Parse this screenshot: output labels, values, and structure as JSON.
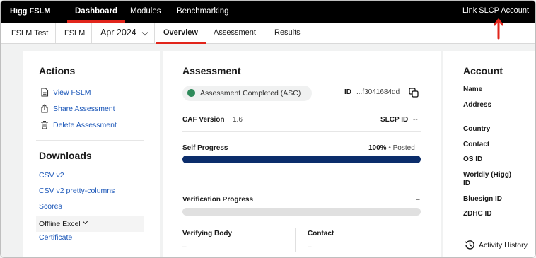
{
  "topbar": {
    "brand": "Higg FSLM",
    "nav": [
      "Dashboard",
      "Modules",
      "Benchmarking"
    ],
    "link_slcp": "Link SLCP Account"
  },
  "subbar": {
    "crumbs": [
      "FSLM Test",
      "FSLM"
    ],
    "period": "Apr 2024",
    "tabs": [
      "Overview",
      "Assessment",
      "Results"
    ]
  },
  "actions": {
    "title": "Actions",
    "items": [
      {
        "label": "View FSLM",
        "icon": "document-icon"
      },
      {
        "label": "Share Assessment",
        "icon": "share-icon"
      },
      {
        "label": "Delete Assessment",
        "icon": "trash-icon"
      }
    ]
  },
  "downloads": {
    "title": "Downloads",
    "items": [
      "CSV v2",
      "CSV v2 pretty-columns",
      "Scores"
    ],
    "offline": "Offline Excel",
    "certificate": "Certificate"
  },
  "assessment": {
    "title": "Assessment",
    "status": "Assessment Completed (ASC)",
    "id_label": "ID",
    "id_value": "...f3041684dd",
    "caf_label": "CAF Version",
    "caf_value": "1.6",
    "slcp_label": "SLCP ID",
    "slcp_value": "--",
    "self_progress_label": "Self Progress",
    "self_progress_value": "100%",
    "self_progress_status": "Posted",
    "self_progress_fraction": 1.0,
    "verification_label": "Verification Progress",
    "verification_value": "–",
    "verification_fraction": 0,
    "verifying_body_label": "Verifying Body",
    "verifying_body_value": "–",
    "contact_label": "Contact",
    "contact_value": "–"
  },
  "account": {
    "title": "Account",
    "fields": [
      "Name",
      "Address",
      "Country",
      "Contact",
      "OS ID",
      "Worldly (Higg) ID",
      "Bluesign ID",
      "ZDHC ID"
    ],
    "activity": "Activity History"
  },
  "colors": {
    "accent_red": "#e1251b",
    "link_blue": "#1a56b8",
    "progress_navy": "#0b2d6b",
    "status_green": "#2e8a5a"
  }
}
